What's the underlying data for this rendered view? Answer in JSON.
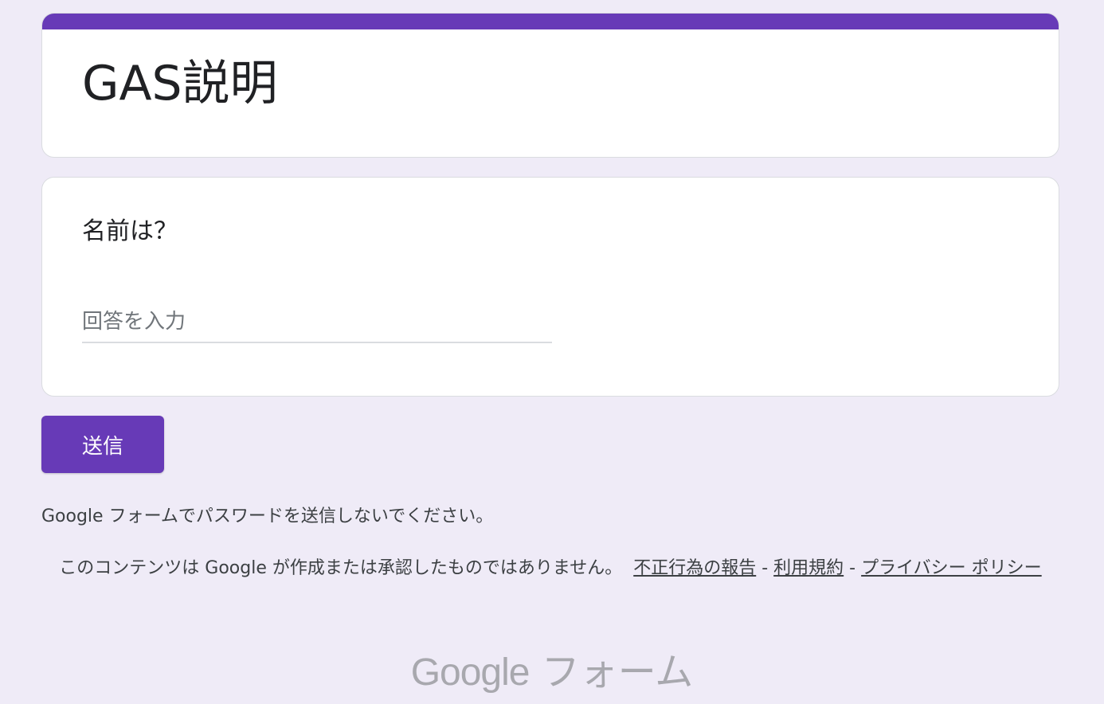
{
  "header": {
    "title": "GAS説明",
    "accent_color": "#673ab7"
  },
  "question": {
    "label": "名前は？",
    "input_placeholder": "回答を入力",
    "input_value": ""
  },
  "actions": {
    "submit_label": "送信"
  },
  "footer": {
    "password_warning": "Google フォームでパスワードを送信しないでください。",
    "disclaimer_text": "このコンテンツは Google が作成または承認したものではありません。",
    "links": {
      "report_abuse": "不正行為の報告",
      "separator": " - ",
      "terms": "利用規約",
      "privacy": "プライバシー ポリシー"
    },
    "logo": {
      "brand": "Google",
      "product": "フォーム"
    }
  }
}
